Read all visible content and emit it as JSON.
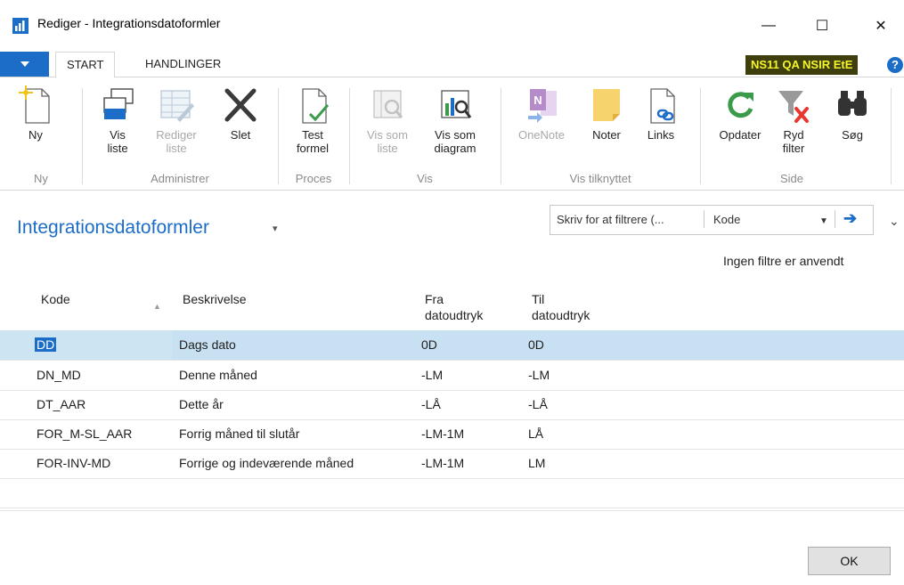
{
  "window": {
    "title": "Rediger - Integrationsdatoformler",
    "minimize": "—",
    "maximize": "☐",
    "close": "✕"
  },
  "ribbon_tabs": [
    "START",
    "HANDLINGER"
  ],
  "environment_badge": "NS11 QA NSIR EtE",
  "help": "?",
  "ribbon": {
    "groups": {
      "ny": "Ny",
      "administrer": "Administrer",
      "proces": "Proces",
      "vis": "Vis",
      "vis_tilknyttet": "Vis tilknyttet",
      "side": "Side"
    },
    "buttons": {
      "ny": "Ny",
      "vis_liste_1": "Vis",
      "vis_liste_2": "liste",
      "rediger_liste_1": "Rediger",
      "rediger_liste_2": "liste",
      "slet": "Slet",
      "test_formel_1": "Test",
      "test_formel_2": "formel",
      "vis_som_liste_1": "Vis som",
      "vis_som_liste_2": "liste",
      "vis_som_diagram_1": "Vis som",
      "vis_som_diagram_2": "diagram",
      "onenote": "OneNote",
      "noter": "Noter",
      "links": "Links",
      "opdater": "Opdater",
      "ryd_filter_1": "Ryd",
      "ryd_filter_2": "filter",
      "soeg": "Søg"
    }
  },
  "page": {
    "title": "Integrationsdatoformler",
    "filter_placeholder": "Skriv for at filtrere (...",
    "filter_field": "Kode",
    "no_filters": "Ingen filtre er anvendt"
  },
  "table": {
    "headers": {
      "kode": "Kode",
      "beskrivelse": "Beskrivelse",
      "fra_1": "Fra",
      "fra_2": "datoudtryk",
      "til_1": "Til",
      "til_2": "datoudtryk"
    },
    "rows": [
      {
        "kode": "DD",
        "beskrivelse": "Dags dato",
        "fra": "0D",
        "til": "0D"
      },
      {
        "kode": "DN_MD",
        "beskrivelse": "Denne måned",
        "fra": "-LM",
        "til": "-LM"
      },
      {
        "kode": "DT_AAR",
        "beskrivelse": "Dette år",
        "fra": "-LÅ",
        "til": "-LÅ"
      },
      {
        "kode": "FOR_M-SL_AAR",
        "beskrivelse": "Forrig måned til slutår",
        "fra": "-LM-1M",
        "til": "LÅ"
      },
      {
        "kode": "FOR-INV-MD",
        "beskrivelse": "Forrige og indeværende måned",
        "fra": "-LM-1M",
        "til": "LM"
      }
    ]
  },
  "footer": {
    "ok": "OK"
  },
  "colors": {
    "accent": "#1c6dc8",
    "selected_row": "#cde4f3",
    "badge_bg": "#3e3f0c",
    "badge_fg": "#f5f52d"
  }
}
